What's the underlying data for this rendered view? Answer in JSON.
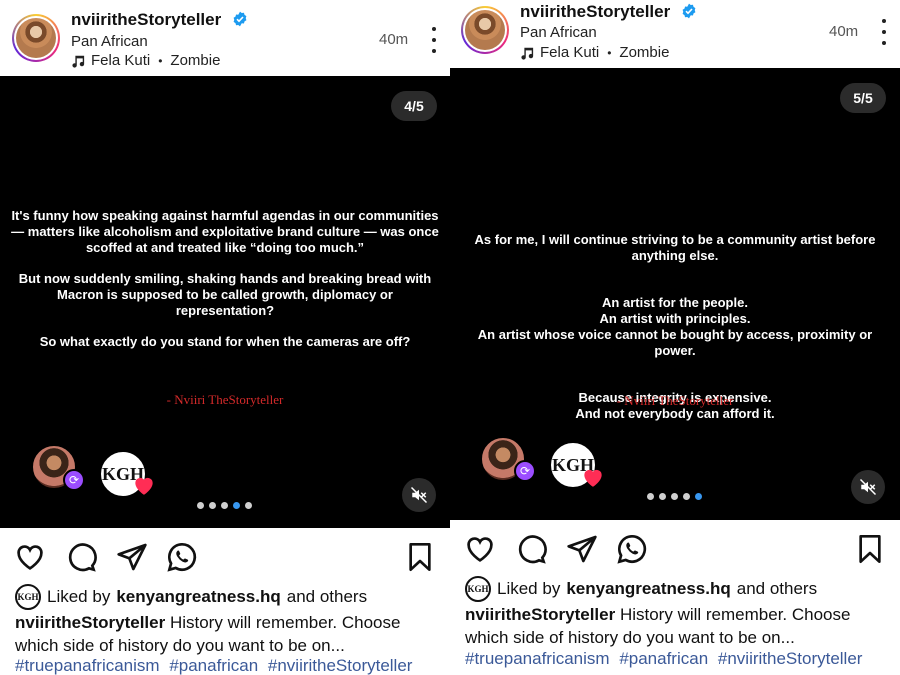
{
  "posts": [
    {
      "username": "nviiritheStoryteller",
      "subtitle": "Pan African",
      "music": {
        "artist": "Fela Kuti",
        "song": "Zombie"
      },
      "time": "40m",
      "counter": "4/5",
      "story": [
        "It's funny how speaking against harmful agendas in our communities — matters like alcoholism and exploitative brand culture — was once scoffed at and treated like “doing too much.”",
        "But now suddenly smiling, shaking hands and breaking bread with Macron is supposed to be called growth, diplomacy or representation?",
        "So what exactly do you stand for when the cameras are off?"
      ],
      "signature": "- Nviiri TheStoryteller",
      "kgh_label": "KGH",
      "active_dot": 4,
      "liked_by": {
        "prefix": "Liked by",
        "user": "kenyangreatness.hq",
        "suffix": "and others"
      },
      "caption": {
        "user": "nviiritheStoryteller",
        "text": "History will remember. Choose which side of history do you want to be on..."
      },
      "hashtags": [
        "#truepanafricanism",
        "#panafrican",
        "#nviiritheStoryteller"
      ]
    },
    {
      "username": "nviiritheStoryteller",
      "subtitle": "Pan African",
      "music": {
        "artist": "Fela Kuti",
        "song": "Zombie"
      },
      "time": "40m",
      "counter": "5/5",
      "story": [
        "As for me, I will continue striving to be a community artist before anything else.",
        "An artist for the people.\nAn artist with principles.\nAn artist whose voice cannot be bought by access, proximity or power.",
        "Because integrity is expensive.\nAnd not everybody can afford it."
      ],
      "signature": "- Nviiri TheStoryteller",
      "kgh_label": "KGH",
      "active_dot": 5,
      "liked_by": {
        "prefix": "Liked by",
        "user": "kenyangreatness.hq",
        "suffix": "and others"
      },
      "caption": {
        "user": "nviiritheStoryteller",
        "text": "History will remember. Choose which side of history do you want to be on..."
      },
      "hashtags": [
        "#truepanafricanism",
        "#panafrican",
        "#nviiritheStoryteller"
      ]
    }
  ],
  "colors": {
    "link": "#3b5998",
    "signature": "#d42a2a",
    "active_dot": "#3897f0",
    "verified": "#1d9bf0"
  },
  "icons": [
    "like-heart-icon",
    "comment-icon",
    "share-icon",
    "whatsapp-icon",
    "bookmark-icon",
    "mute-icon",
    "verified-icon",
    "music-note-icon",
    "more-options-icon"
  ]
}
